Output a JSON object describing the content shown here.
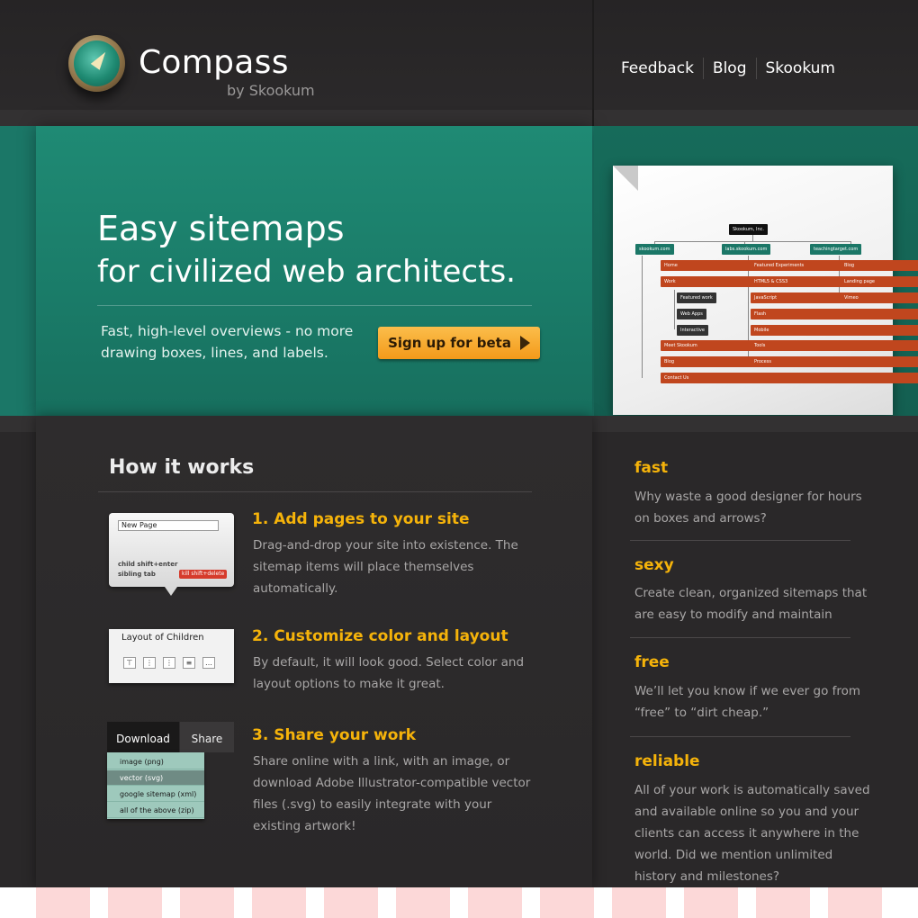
{
  "brand": {
    "title": "Compass",
    "subtitle": "by Skookum"
  },
  "nav": [
    {
      "label": "Feedback"
    },
    {
      "label": "Blog"
    },
    {
      "label": "Skookum"
    }
  ],
  "hero": {
    "line1": "Easy sitemaps",
    "line2": "for civilized web architects.",
    "description": "Fast, high-level overviews - no more drawing boxes, lines, and labels.",
    "cta": "Sign up for beta"
  },
  "sitemap_preview": {
    "root": "Skookum, Inc.",
    "sites": [
      "skookum.com",
      "labs.skookum.com",
      "teachingtarget.com"
    ],
    "col1": [
      "Home",
      "Work",
      "Meet Skookum",
      "Blog",
      "Contact Us"
    ],
    "col1_sub": [
      "Featured work",
      "Web Apps",
      "Interactive"
    ],
    "col2": [
      "Featured Experiments",
      "HTML5 & CSS3",
      "JavaScript",
      "Flash",
      "Mobile",
      "Tools",
      "Process"
    ],
    "col3": [
      "Blog",
      "Landing page",
      "Vimeo"
    ]
  },
  "how": {
    "title": "How it works",
    "steps": [
      {
        "title": "1. Add pages to your site",
        "text": "Drag-and-drop your site into existence. The sitemap items will place themselves automatically."
      },
      {
        "title": "2. Customize color and layout",
        "text": "By default, it will look good. Select color and layout options to make it great."
      },
      {
        "title": "3. Share your work",
        "text": "Share online with a link, with an image, or download Adobe Illustrator-compatible vector files (.svg) to easily integrate with your existing artwork!"
      }
    ],
    "thumb1": {
      "field": "New Page",
      "hint1": "child shift+enter",
      "hint2": "sibling tab",
      "kill": "kill shift+delete"
    },
    "thumb2": {
      "title": "Layout of Children"
    },
    "thumb3": {
      "tab1": "Download",
      "tab2": "Share",
      "items": [
        "image (png)",
        "vector (svg)",
        "google sitemap (xml)",
        "all of the above (zip)"
      ]
    }
  },
  "features": [
    {
      "title": "fast",
      "text": "Why waste a good designer for hours on boxes and arrows?"
    },
    {
      "title": "sexy",
      "text": "Create clean, organized sitemaps that are easy to modify and maintain"
    },
    {
      "title": "free",
      "text": "We’ll let you know if we ever go from “free” to “dirt cheap.”"
    },
    {
      "title": "reliable",
      "text": "All of your work is automatically saved and available online so you and your clients can access it anywhere in the world. Did we mention unlimited history and milestones?"
    }
  ],
  "colors": {
    "teal": "#1b7767",
    "accent": "#f5b30a",
    "cta": "#f39a1a",
    "dark": "#2a2829"
  }
}
